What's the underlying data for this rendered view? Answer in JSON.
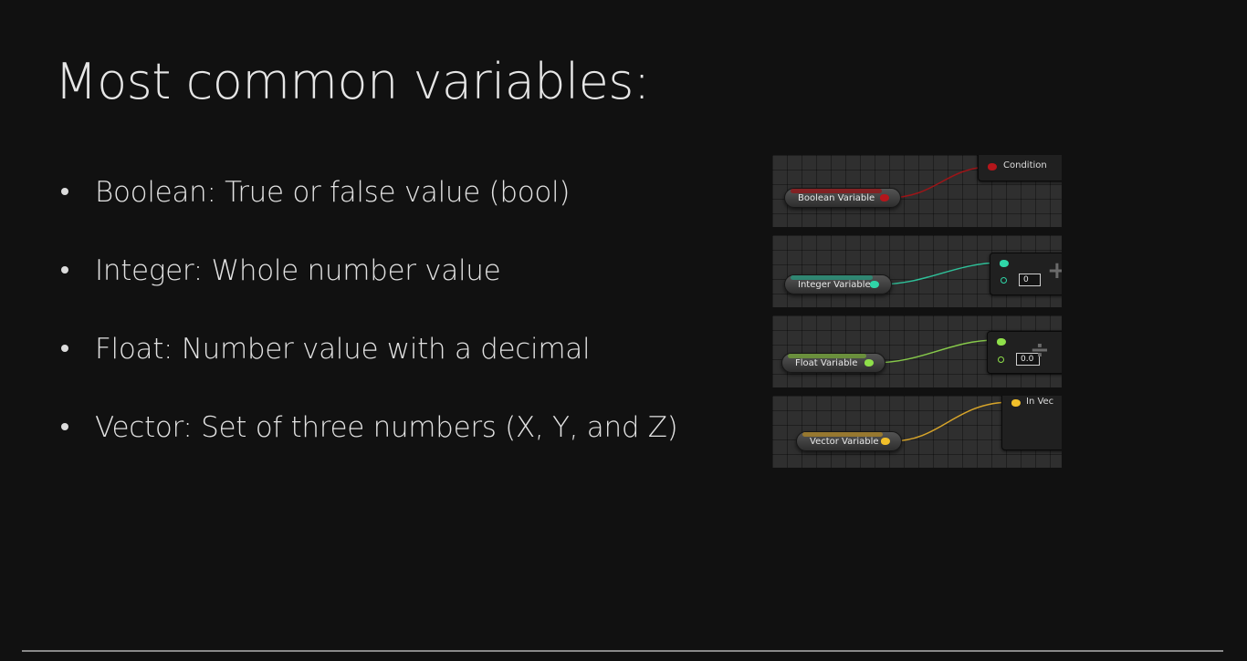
{
  "slide": {
    "title": "Most common variables:",
    "bullets": [
      {
        "text": "Boolean: True or false value (bool)"
      },
      {
        "text": "Integer: Whole number value"
      },
      {
        "text": "Float: Number value with a decimal"
      },
      {
        "text": "Vector: Set of three numbers (X, Y, and Z)"
      }
    ]
  },
  "blueprint_examples": {
    "boolean": {
      "variable_label": "Boolean Variable",
      "target_pin_label": "Condition",
      "color": "#b5161b"
    },
    "integer": {
      "variable_label": "Integer Variable",
      "default_value": "0",
      "color": "#2fd6a8"
    },
    "float": {
      "variable_label": "Float Variable",
      "default_value": "0.0",
      "color": "#8fe04a"
    },
    "vector": {
      "variable_label": "Vector Variable",
      "target_pin_label": "In Vec",
      "color": "#f2c02a"
    }
  },
  "icons": {
    "bullet": "bullet-dot-icon",
    "add": "plus-icon",
    "divide": "divide-icon"
  }
}
